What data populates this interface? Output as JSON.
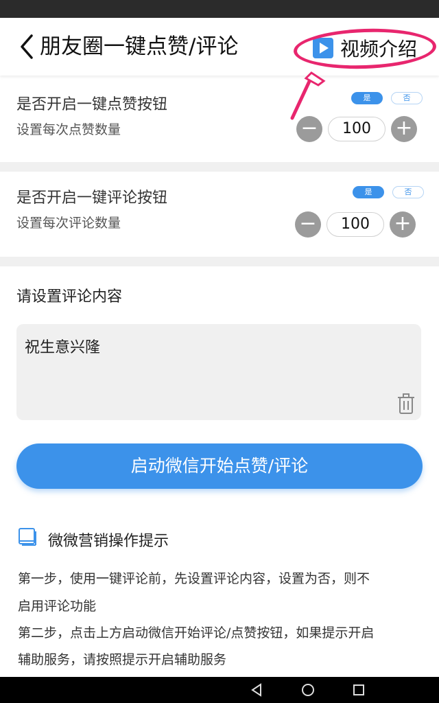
{
  "header": {
    "title": "朋友圈一键点赞/评论",
    "video_label": "视频介绍"
  },
  "like_section": {
    "toggle_label": "是否开启一键点赞按钮",
    "yes_label": "是",
    "no_label": "否",
    "count_label": "设置每次点赞数量",
    "count_value": "100",
    "minus_label": "−",
    "plus_label": "+"
  },
  "comment_section": {
    "toggle_label": "是否开启一键评论按钮",
    "yes_label": "是",
    "no_label": "否",
    "count_label": "设置每次评论数量",
    "count_value": "100",
    "minus_label": "−",
    "plus_label": "+"
  },
  "comment_content": {
    "title": "请设置评论内容",
    "value": "祝生意兴隆"
  },
  "start_button": "启动微信开始点赞/评论",
  "tips": {
    "title": "微微营销操作提示",
    "lines": [
      "第一步，使用一键评论前，先设置评论内容，设置为否，则不",
      "启用评论功能",
      "第二步，点击上方启动微信开始评论/点赞按钮，如果提示开启",
      "辅助服务，请按照提示开启辅助服务"
    ]
  },
  "colors": {
    "accent": "#3c92ea",
    "annotation": "#e8266e",
    "stepper_gray": "#9b9b9b"
  }
}
